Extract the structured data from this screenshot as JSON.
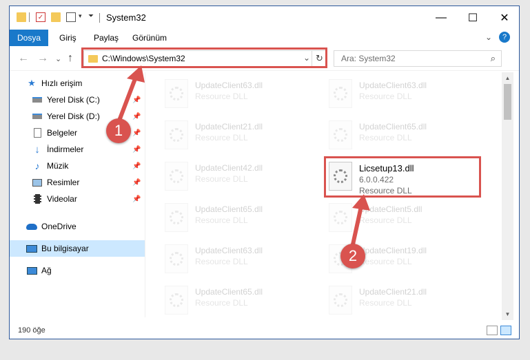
{
  "window": {
    "title": "System32",
    "controls": {
      "minimize": "—",
      "maximize": "☐",
      "close": "✕"
    }
  },
  "ribbon": {
    "tabs": [
      "Dosya",
      "Giriş",
      "Paylaş",
      "Görünüm"
    ],
    "expand": "⌄",
    "help": "?"
  },
  "address": {
    "path": "C:\\Windows\\System32",
    "refresh": "↻",
    "dropdown": "⌄"
  },
  "search": {
    "placeholder": "Ara: System32",
    "icon": "search-icon"
  },
  "nav": {
    "back": "←",
    "forward": "→",
    "recent": "⌄",
    "up": "↑"
  },
  "sidebar": {
    "items": [
      {
        "label": "Hızlı erişim",
        "icon": "star-icon",
        "pinned": false
      },
      {
        "label": "Yerel Disk (C:)",
        "icon": "drive-icon",
        "pinned": true
      },
      {
        "label": "Yerel Disk (D:)",
        "icon": "drive-icon",
        "pinned": true
      },
      {
        "label": "Belgeler",
        "icon": "documents-icon",
        "pinned": true
      },
      {
        "label": "İndirmeler",
        "icon": "downloads-icon",
        "pinned": true
      },
      {
        "label": "Müzik",
        "icon": "music-icon",
        "pinned": true
      },
      {
        "label": "Resimler",
        "icon": "pictures-icon",
        "pinned": true
      },
      {
        "label": "Videolar",
        "icon": "videos-icon",
        "pinned": true
      },
      {
        "label": "OneDrive",
        "icon": "cloud-icon",
        "pinned": false
      },
      {
        "label": "Bu bilgisayar",
        "icon": "computer-icon",
        "pinned": false
      },
      {
        "label": "Ağ",
        "icon": "network-icon",
        "pinned": false
      }
    ],
    "pin_glyph": "📌"
  },
  "files": {
    "left": [
      {
        "name": "UpdateClient63.dll",
        "type": "Resource DLL"
      },
      {
        "name": "UpdateClient21.dll",
        "type": "Resource DLL"
      },
      {
        "name": "UpdateClient42.dll",
        "type": "Resource DLL"
      },
      {
        "name": "UpdateClient65.dll",
        "type": "Resource DLL"
      },
      {
        "name": "UpdateClient63.dll",
        "type": "Resource DLL"
      },
      {
        "name": "UpdateClient65.dll",
        "type": "Resource DLL"
      }
    ],
    "right": [
      {
        "name": "UpdateClient63.dll",
        "type": "Resource DLL"
      },
      {
        "name": "UpdateClient65.dll",
        "type": "Resource DLL"
      },
      {
        "name": "UpdateClient5.dll",
        "type": "Resource DLL"
      },
      {
        "name": "UpdateClient19.dll",
        "type": "Resource DLL"
      },
      {
        "name": "UpdateClient21.dll",
        "type": "Resource DLL"
      }
    ],
    "highlighted": {
      "name": "Licsetup13.dll",
      "version": "6.0.0.422",
      "type": "Resource DLL"
    }
  },
  "status": {
    "count": "190 öğe"
  },
  "callouts": {
    "one": "1",
    "two": "2"
  },
  "colors": {
    "accent": "#1979ca",
    "highlight": "#d9534f",
    "selected": "#cce8ff"
  }
}
